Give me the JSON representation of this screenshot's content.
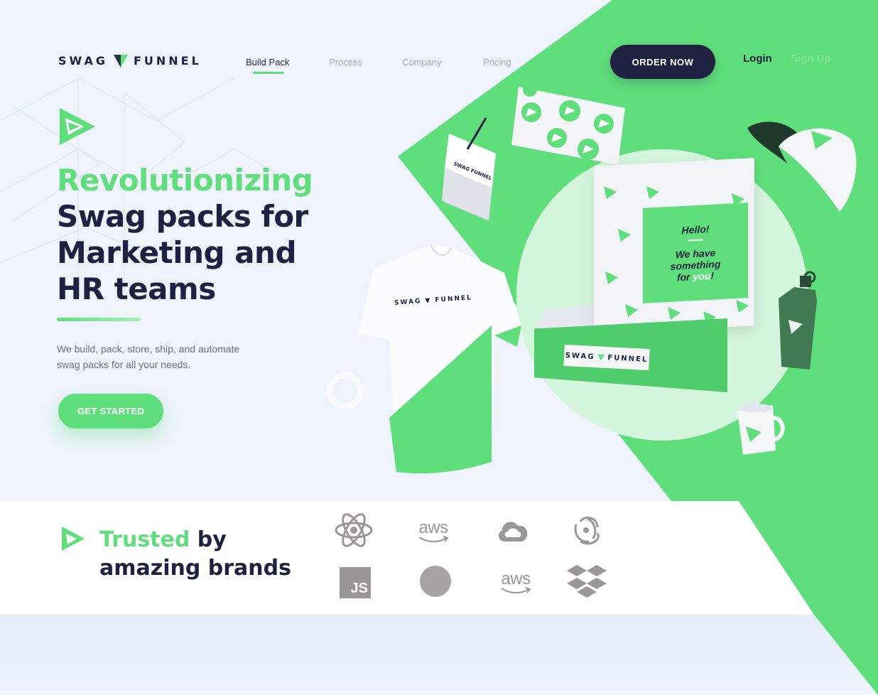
{
  "brand": {
    "name_left": "SWAG",
    "name_right": "FUNNEL",
    "accent_color": "#5fdf7c",
    "dark_color": "#1e2240",
    "logo_icon": "triangle-funnel-icon"
  },
  "nav": {
    "links": [
      {
        "label": "Build Pack",
        "active": true
      },
      {
        "label": "Process",
        "active": false
      },
      {
        "label": "Company",
        "active": false
      },
      {
        "label": "Pricing",
        "active": false
      }
    ],
    "order_label": "ORDER NOW",
    "login_label": "Login",
    "signup_label": "Sign Up"
  },
  "hero": {
    "icon": "play-triangle-icon",
    "headline_accent": "Revolutionizing",
    "headline_lines": [
      "Swag packs for",
      "Marketing and",
      "HR teams"
    ],
    "subtitle_line1": "We build, pack, store, ship, and automate",
    "subtitle_line2": "swag packs for all your needs.",
    "cta_label": "GET STARTED"
  },
  "products": {
    "box_card": {
      "hello": "Hello!",
      "line1": "We have",
      "line2": "something",
      "line3_prefix": "for ",
      "line3_accent": "you",
      "line3_suffix": "!"
    },
    "box_label_left": "SWAG",
    "box_label_right": "FUNNEL",
    "shirt_label": "SWAG ▼ FUNNEL"
  },
  "trusted": {
    "icon": "play-triangle-icon",
    "title_accent": "Trusted",
    "title_rest1": " by",
    "title_line2": "amazing brands",
    "brands_row1": [
      "react-icon",
      "aws-logo",
      "google-cloud-icon",
      "redux-icon"
    ],
    "brands_row2": [
      "javascript-logo",
      "gray-circle-logo",
      "aws-logo",
      "dropbox-icon"
    ],
    "aws_text": "aws",
    "js_text": "JS"
  }
}
